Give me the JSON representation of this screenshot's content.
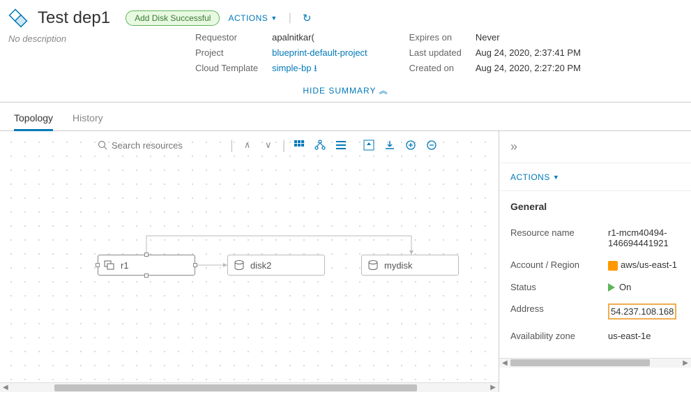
{
  "header": {
    "title": "Test dep1",
    "badge": "Add Disk Successful",
    "actions_label": "ACTIONS",
    "description": "No description"
  },
  "summary": {
    "requestor_label": "Requestor",
    "requestor_value": "apalnitkar(",
    "project_label": "Project",
    "project_value": "blueprint-default-project",
    "template_label": "Cloud Template",
    "template_value": "simple-bp",
    "expires_label": "Expires on",
    "expires_value": "Never",
    "updated_label": "Last updated",
    "updated_value": "Aug 24, 2020, 2:37:41 PM",
    "created_label": "Created on",
    "created_value": "Aug 24, 2020, 2:27:20 PM",
    "hide_label": "HIDE SUMMARY"
  },
  "tabs": {
    "topology": "Topology",
    "history": "History"
  },
  "toolbar": {
    "search_placeholder": "Search resources"
  },
  "nodes": {
    "r1": "r1",
    "disk2": "disk2",
    "mydisk": "mydisk"
  },
  "side": {
    "actions_label": "ACTIONS",
    "general_label": "General",
    "rows": {
      "resource_name_label": "Resource name",
      "resource_name_value": "r1-mcm40494-146694441921",
      "account_label": "Account / Region",
      "account_value": "aws/us-east-1",
      "status_label": "Status",
      "status_value": "On",
      "address_label": "Address",
      "address_value": "54.237.108.168",
      "az_label": "Availability zone",
      "az_value": "us-east-1e"
    }
  }
}
